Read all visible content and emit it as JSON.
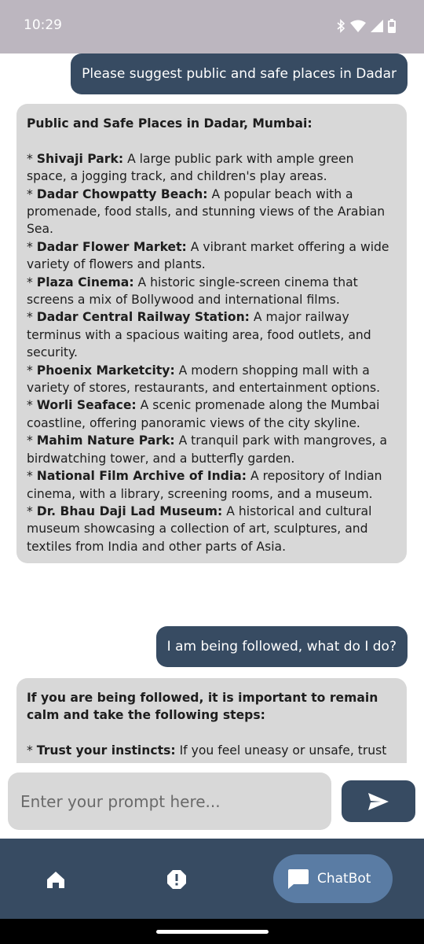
{
  "status_bar": {
    "time": "10:29"
  },
  "messages": [
    {
      "role": "user",
      "text": "Please suggest public and safe places in Dadar"
    },
    {
      "role": "bot",
      "title": "Public and Safe Places in Dadar, Mumbai:",
      "items": [
        {
          "name": "Shivaji Park:",
          "desc": "A large public park with ample green space, a jogging track, and children's play areas."
        },
        {
          "name": "Dadar Chowpatty Beach:",
          "desc": "A popular beach with a promenade, food stalls, and stunning views of the Arabian Sea."
        },
        {
          "name": "Dadar Flower Market:",
          "desc": "A vibrant market offering a wide variety of flowers and plants."
        },
        {
          "name": "Plaza Cinema:",
          "desc": "A historic single-screen cinema that screens a mix of Bollywood and international films."
        },
        {
          "name": "Dadar Central Railway Station:",
          "desc": "A major railway terminus with a spacious waiting area, food outlets, and security."
        },
        {
          "name": "Phoenix Marketcity:",
          "desc": "A modern shopping mall with a variety of stores, restaurants, and entertainment options."
        },
        {
          "name": "Worli Seaface:",
          "desc": "A scenic promenade along the Mumbai coastline, offering panoramic views of the city skyline."
        },
        {
          "name": "Mahim Nature Park:",
          "desc": "A tranquil park with mangroves, a birdwatching tower, and a butterfly garden."
        },
        {
          "name": "National Film Archive of India:",
          "desc": "A repository of Indian cinema, with a library, screening rooms, and a museum."
        },
        {
          "name": "Dr. Bhau Daji Lad Museum:",
          "desc": "A historical and cultural museum showcasing a collection of art, sculptures, and textiles from India and other parts of Asia."
        }
      ]
    },
    {
      "role": "user",
      "text": "I am being followed, what do I do?"
    },
    {
      "role": "bot",
      "title": "If you are being followed, it is important to remain calm and take the following steps:",
      "items": [
        {
          "name": "Trust your instincts:",
          "desc": "If you feel uneasy or unsafe, trust your gut and take action."
        }
      ]
    }
  ],
  "input": {
    "placeholder": "Enter your prompt here..."
  },
  "bottom_nav": {
    "chatbot_label": "ChatBot"
  },
  "icons": {
    "send": "send-icon",
    "home": "home-icon",
    "alert": "alert-icon",
    "chat": "chat-bubble-icon"
  },
  "colors": {
    "accent": "#374b62",
    "bubble_bot": "#d8d8d8",
    "nav_active": "#5a7ca4"
  }
}
